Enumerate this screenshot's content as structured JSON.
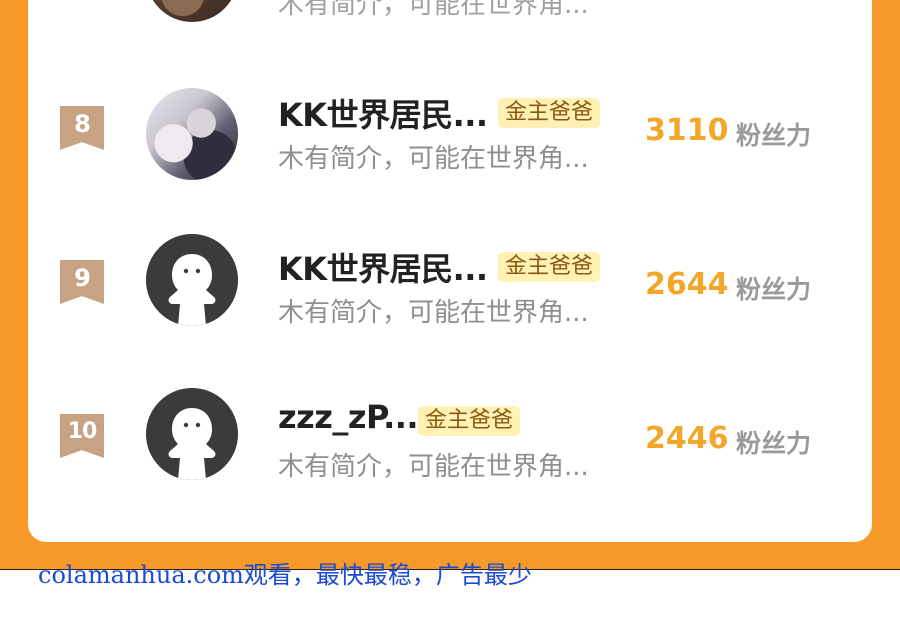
{
  "colors": {
    "frame": "#f79a2a",
    "card": "#ffffff",
    "rank_badge": "#c7a384",
    "score": "#f2a62a",
    "tag_bg": "#fff0b3",
    "watermark": "#1b4bd1"
  },
  "ranking": {
    "top_partial_bio": "木有简介，可能在世界角...",
    "entries": [
      {
        "rank": "8",
        "name": "KK世界居民...",
        "tag": "金主爸爸",
        "bio": "木有简介，可能在世界角...",
        "score": "3110",
        "score_unit": "粉丝力",
        "avatar": "photo-avatar"
      },
      {
        "rank": "9",
        "name": "KK世界居民...",
        "tag": "金主爸爸",
        "bio": "木有简介，可能在世界角...",
        "score": "2644",
        "score_unit": "粉丝力",
        "avatar": "default-ghost-avatar"
      },
      {
        "rank": "10",
        "name": "zzz_zP...",
        "tag": "金主爸爸",
        "bio": "木有简介，可能在世界角...",
        "score": "2446",
        "score_unit": "粉丝力",
        "avatar": "default-ghost-avatar"
      }
    ]
  },
  "watermark": {
    "text": "colamanhua.com观看，最快最稳，广告最少"
  }
}
